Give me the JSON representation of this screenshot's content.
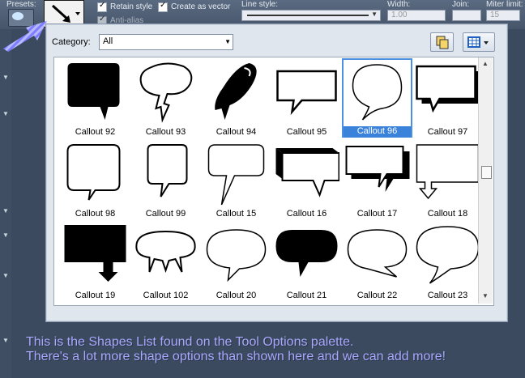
{
  "toolbar": {
    "presets_label": "Presets:",
    "retain_style_label": "Retain style",
    "create_as_vector_label": "Create as vector",
    "anti_alias_label": "Anti-alias",
    "line_style_label": "Line style:",
    "width_label": "Width:",
    "width_value": "1.00",
    "join_label": "Join:",
    "miter_label": "Miter limit:",
    "miter_value": "15"
  },
  "dialog": {
    "category_label": "Category:",
    "category_value": "All"
  },
  "shapes": [
    {
      "label": "Callout 92",
      "shape": "dark-square-bubble"
    },
    {
      "label": "Callout 93",
      "shape": "cloud-jagged-bubble"
    },
    {
      "label": "Callout 94",
      "shape": "dark-leaf-bubble"
    },
    {
      "label": "Callout 95",
      "shape": "rect-bubble"
    },
    {
      "label": "Callout 96",
      "shape": "circle-comma-bubble"
    },
    {
      "label": "Callout 97",
      "shape": "shadow-rect-bubble"
    },
    {
      "label": "Callout 98",
      "shape": "rounded-rect-bubble"
    },
    {
      "label": "Callout 99",
      "shape": "tall-rounded-bubble"
    },
    {
      "label": "Callout 15",
      "shape": "rounded-tail-bubble"
    },
    {
      "label": "Callout 16",
      "shape": "3d-rect-bubble"
    },
    {
      "label": "Callout 17",
      "shape": "3d-rect-bubble-2"
    },
    {
      "label": "Callout 18",
      "shape": "rect-arrow-bubble"
    },
    {
      "label": "Callout 19",
      "shape": "dark-rect-arrow"
    },
    {
      "label": "Callout 102",
      "shape": "fang-bubble"
    },
    {
      "label": "Callout 20",
      "shape": "oval-bubble"
    },
    {
      "label": "Callout 21",
      "shape": "dark-pill-bubble"
    },
    {
      "label": "Callout 22",
      "shape": "oval-bubble-2"
    },
    {
      "label": "Callout 23",
      "shape": "oval-bubble-3"
    }
  ],
  "selected": "Callout 96",
  "caption": {
    "line1": "This is the Shapes List found on the Tool Options palette.",
    "line2": "There's a lot more shape options than shown here and we can add more!"
  },
  "colors": {
    "caption": "#a9a9ff",
    "selection": "#3b82db"
  }
}
